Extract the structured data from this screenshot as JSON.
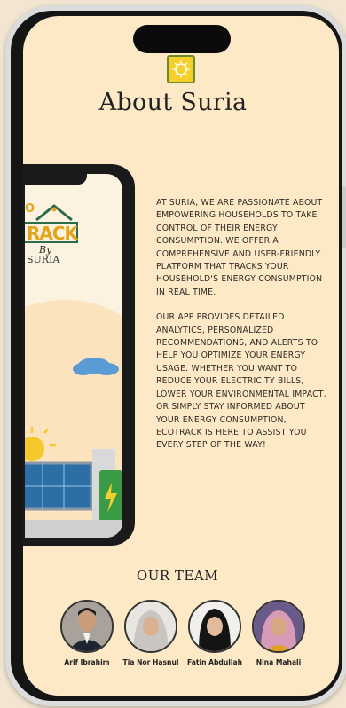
{
  "page": {
    "title": "About Suria",
    "logo_icon": "sun-logo-icon",
    "accent_color": "#f6d02a"
  },
  "mockup": {
    "eco_top_text": "O",
    "eco_logo_text": "RACK",
    "by_text": "By",
    "suria_text": "SURIA"
  },
  "about": {
    "paragraph1": "At Suria, we are passionate about empowering households to take control of their energy consumption. We offer a comprehensive and user-friendly platform that tracks your household's energy consumption in real time.",
    "paragraph2": "Our app provides detailed analytics, personalized recommendations, and alerts to help you optimize your energy usage. Whether you want to reduce your electricity bills, lower your environmental impact, or simply stay informed about your energy consumption, EcoTrack is here to assist you every step of the way!"
  },
  "team": {
    "heading": "OUR TEAM",
    "members": [
      {
        "name": "Arif Ibrahim"
      },
      {
        "name": "Tia Nor Hasnul"
      },
      {
        "name": "Fatin Abdullah"
      },
      {
        "name": "Nina Mahali"
      }
    ]
  }
}
